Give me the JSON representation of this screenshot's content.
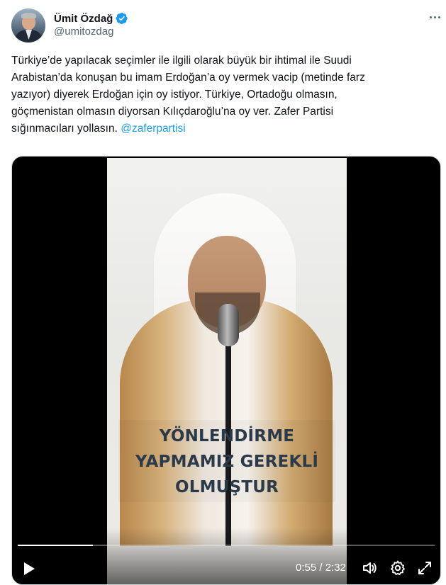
{
  "author": {
    "display_name": "Ümit Özdağ",
    "handle": "@umitozdag",
    "verified": true
  },
  "tweet": {
    "text_line1": "Türkiye’de yapılacak seçimler ile ilgili olarak büyük bir ihtimal ile Suudi",
    "text_line2": "Arabistan’da konuşan bu imam Erdoğan’a oy vermek vacip (metinde farz",
    "text_line3": "yazıyor) diyerek Erdoğan için oy istiyor. Türkiye, Ortadoğu olmasın,",
    "text_line4": "göçmenistan olmasın diyorsan Kılıçdaroğlu’na oy ver. Zafer Partisi",
    "text_line5": "sığınmacıları yollasın. ",
    "mention": "@zaferpartisi"
  },
  "video": {
    "caption_line1": "YÖNLENDİRME",
    "caption_line2": "YAPMAMIZ GEREKLİ",
    "caption_line3": "OLMUŞTUR",
    "time": "0:55 / 2:32",
    "progress": 0.18
  },
  "icons": {
    "verified": "verified-badge-icon",
    "more": "more-icon",
    "play": "play-icon",
    "volume": "volume-icon",
    "settings": "gear-icon",
    "fullscreen": "fullscreen-icon"
  },
  "colors": {
    "link": "#1d9bf0",
    "verified": "#1d9bf0",
    "secondary_text": "#536471"
  }
}
